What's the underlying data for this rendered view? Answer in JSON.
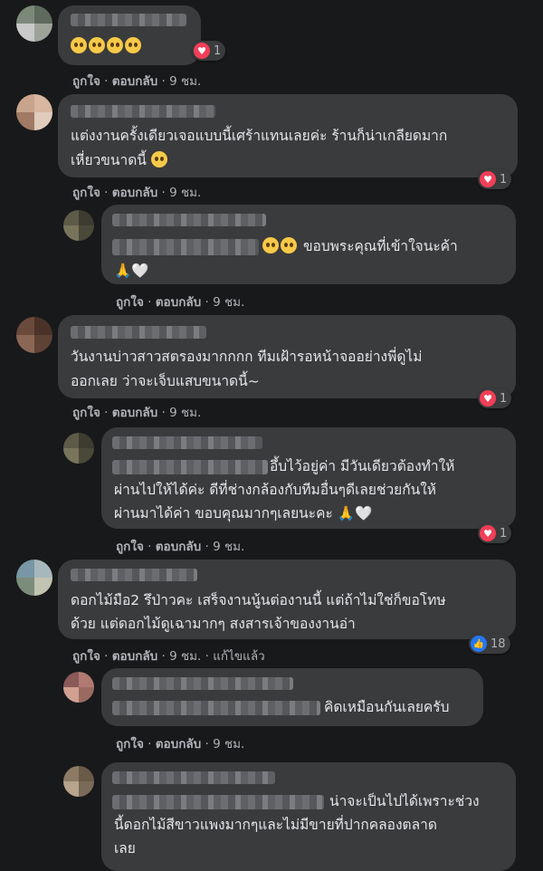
{
  "actions": {
    "like": "ถูกใจ",
    "reply": "ตอบกลับ",
    "time": "9 ชม.",
    "edited": "แก้ไขแล้ว",
    "sep": "·"
  },
  "comments": [
    {
      "lines": [],
      "reaction": "heart",
      "count": "1"
    },
    {
      "lines": [
        "แต่งงานครั้งเดียวเจอแบบนี้เศร้าแทนเลยค่ะ ร้านก็น่าเกลียดมาก",
        "เหี่ยวขนาดนี้"
      ],
      "reaction": "heart",
      "count": "1"
    },
    {
      "lines": [
        "ขอบพระคุณที่เข้าใจนะค้า"
      ]
    },
    {
      "lines": [
        "วันงานบ่าวสาวสตรองมากกกก ทีมเฝ้ารอหน้าจออย่างพี่ดูไม่",
        "ออกเลย ว่าจะเจ็บแสบขนาดนี้~"
      ],
      "reaction": "heart",
      "count": "1"
    },
    {
      "lines": [
        "อึ้บไว้อยู่ค่า มีวันเดียวต้องทำให้",
        "ผ่านไปให้ได้ค่ะ ดีที่ช่างกล้องกับทีมอื่นๆดีเลยช่วยกันให้",
        "ผ่านมาได้ค่า ขอบคุณมากๆเลยนะคะ"
      ],
      "reaction": "heart",
      "count": "1"
    },
    {
      "lines": [
        "ดอกไม้มือ2 รึป่าวคะ เสร็จงานนู้นต่องานนี้ แต่ถ้าไม่ใช่ก็ขอโทษ",
        "ด้วย แต่ดอกไม้ดูเฉามากๆ สงสารเจ้าของงานอ่า"
      ],
      "reaction": "like",
      "count": "18"
    },
    {
      "lines": [
        "คิดเหมือนกันเลยครับ"
      ]
    },
    {
      "lines": [
        "น่าจะเป็นไปได้เพราะช่วง",
        "นี้ดอกไม้สีขาวแพงมากๆและไม่มีขายที่ปากคลองตลาด",
        "เลย"
      ]
    }
  ]
}
